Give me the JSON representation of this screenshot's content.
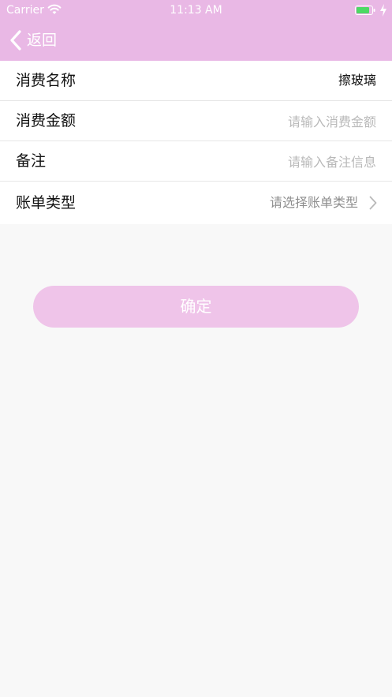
{
  "status_bar": {
    "carrier": "Carrier",
    "time": "11:13 AM",
    "battery_color": "#4cd964"
  },
  "nav": {
    "back_label": "返回",
    "bar_color": "#e9b8e5"
  },
  "form": {
    "name": {
      "label": "消费名称",
      "value": "擦玻璃"
    },
    "amount": {
      "label": "消费金额",
      "placeholder": "请输入消费金额"
    },
    "note": {
      "label": "备注",
      "placeholder": "请输入备注信息"
    },
    "bill_type": {
      "label": "账单类型",
      "placeholder": "请选择账单类型"
    }
  },
  "confirm": {
    "label": "确定",
    "color": "#efc4e9"
  }
}
